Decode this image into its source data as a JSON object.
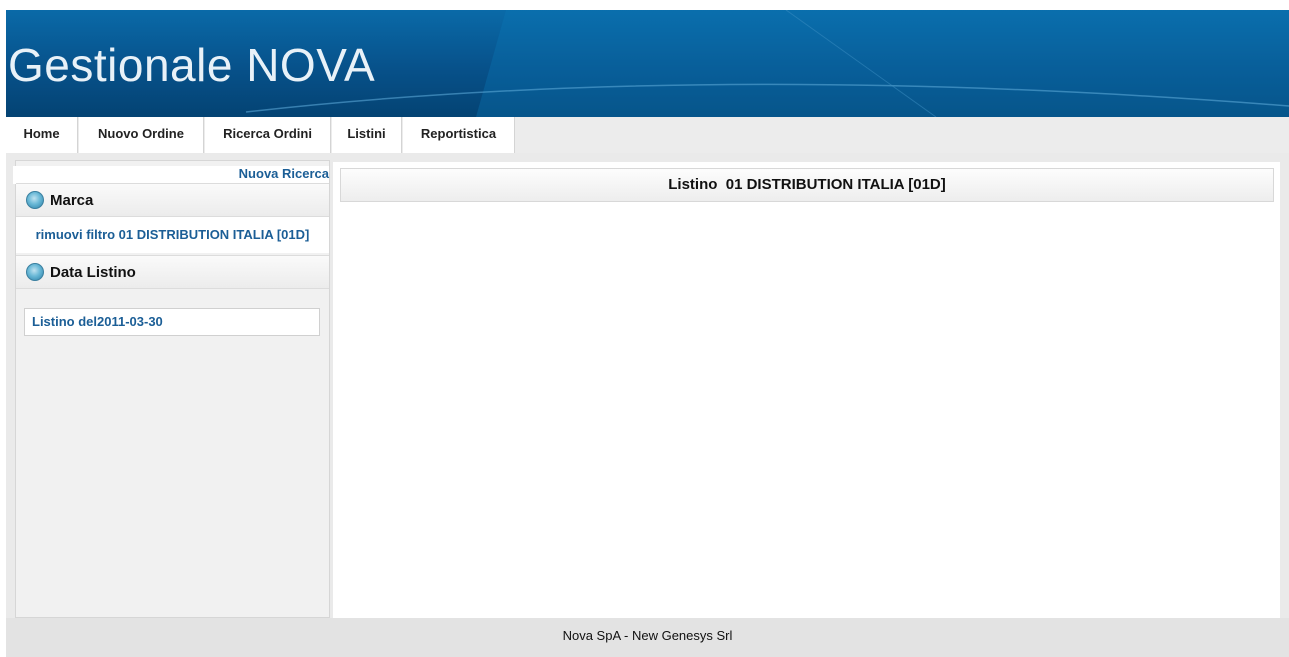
{
  "header": {
    "app_title": "Gestionale NOVA",
    "colors": {
      "banner": "#07518a",
      "link": "#1b5e96"
    }
  },
  "nav": {
    "items": [
      {
        "label": "Home"
      },
      {
        "label": "Nuovo Ordine"
      },
      {
        "label": "Ricerca Ordini"
      },
      {
        "label": "Listini"
      },
      {
        "label": "Reportistica"
      }
    ]
  },
  "sidebar": {
    "new_search": "Nuova Ricerca",
    "sections": [
      {
        "label": "Marca",
        "icon": "bullet-icon"
      },
      {
        "label": "Data Listino",
        "icon": "bullet-icon"
      }
    ],
    "filter_link": "rimuovi filtro 01 DISTRIBUTION ITALIA [01D]",
    "listino_item": "Listino del2011-03-30"
  },
  "main": {
    "heading": "Listino  01 DISTRIBUTION ITALIA [01D]"
  },
  "footer": {
    "text": "Nova SpA - New Genesys Srl"
  }
}
